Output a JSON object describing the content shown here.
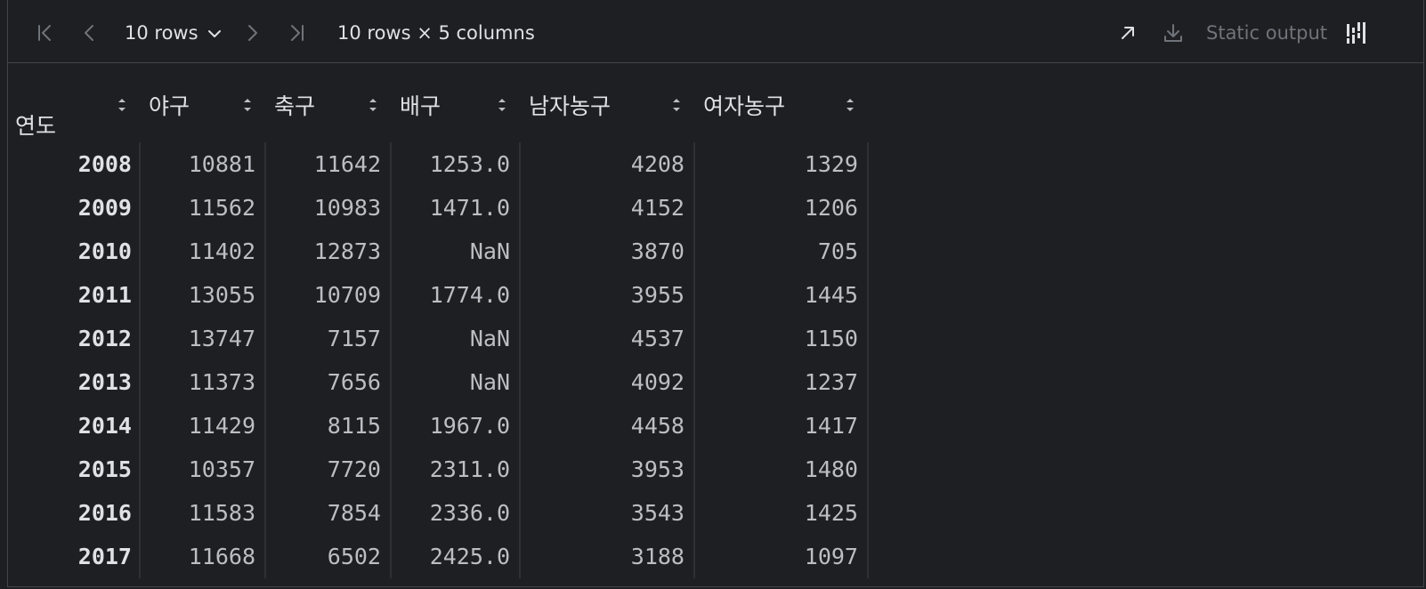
{
  "toolbar": {
    "rows_label": "10 rows",
    "dims_label": "10 rows × 5 columns",
    "static_output_label": "Static output",
    "icons": [
      "first-page-icon",
      "previous-page-icon",
      "chevron-down-icon",
      "next-page-icon",
      "last-page-icon",
      "open-in-new-icon",
      "download-icon",
      "column-chart-icon"
    ]
  },
  "table": {
    "index_name": "연도",
    "columns": [
      "야구",
      "축구",
      "배구",
      "남자농구",
      "여자농구"
    ],
    "rows": [
      {
        "index": "2008",
        "values": [
          "10881",
          "11642",
          "1253.0",
          "4208",
          "1329"
        ]
      },
      {
        "index": "2009",
        "values": [
          "11562",
          "10983",
          "1471.0",
          "4152",
          "1206"
        ]
      },
      {
        "index": "2010",
        "values": [
          "11402",
          "12873",
          "NaN",
          "3870",
          "705"
        ]
      },
      {
        "index": "2011",
        "values": [
          "13055",
          "10709",
          "1774.0",
          "3955",
          "1445"
        ]
      },
      {
        "index": "2012",
        "values": [
          "13747",
          "7157",
          "NaN",
          "4537",
          "1150"
        ]
      },
      {
        "index": "2013",
        "values": [
          "11373",
          "7656",
          "NaN",
          "4092",
          "1237"
        ]
      },
      {
        "index": "2014",
        "values": [
          "11429",
          "8115",
          "1967.0",
          "4458",
          "1417"
        ]
      },
      {
        "index": "2015",
        "values": [
          "10357",
          "7720",
          "2311.0",
          "3953",
          "1480"
        ]
      },
      {
        "index": "2016",
        "values": [
          "11583",
          "7854",
          "2336.0",
          "3543",
          "1425"
        ]
      },
      {
        "index": "2017",
        "values": [
          "11668",
          "6502",
          "2425.0",
          "3188",
          "1097"
        ]
      }
    ]
  },
  "colors": {
    "background": "#1e1f22",
    "border": "#43454a",
    "text": "#dfe1e5",
    "cell_text": "#bcbec4",
    "muted": "#6f737a"
  }
}
